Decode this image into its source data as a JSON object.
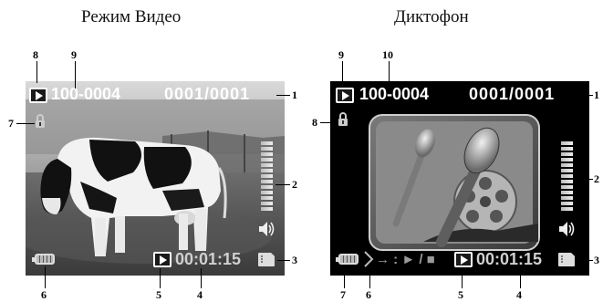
{
  "titles": {
    "left": "Режим Видео",
    "right": "Диктофон"
  },
  "left_screen": {
    "folder_file": "100-0004",
    "counter": "0001/0001",
    "time": "00:01:15",
    "callouts": [
      "1",
      "2",
      "3",
      "4",
      "5",
      "6",
      "7",
      "8",
      "9"
    ]
  },
  "right_screen": {
    "folder_file": "100-0004",
    "counter": "0001/0001",
    "time": "00:01:15",
    "playback_controls": "→ : ► / ■",
    "callouts": [
      "1",
      "2",
      "3",
      "4",
      "5",
      "6",
      "7",
      "8",
      "9",
      "10"
    ]
  },
  "icons": {
    "play": "play-icon",
    "lock": "lock-icon",
    "volume": "speaker-icon",
    "battery": "battery-icon",
    "memory_card": "sd-card-icon",
    "volume_level": "level-bars-icon",
    "headphone_jack": "jack-icon"
  },
  "colors": {
    "screen_bg": "#000000",
    "osd_text": "#ffffff",
    "callout": "#000000"
  }
}
